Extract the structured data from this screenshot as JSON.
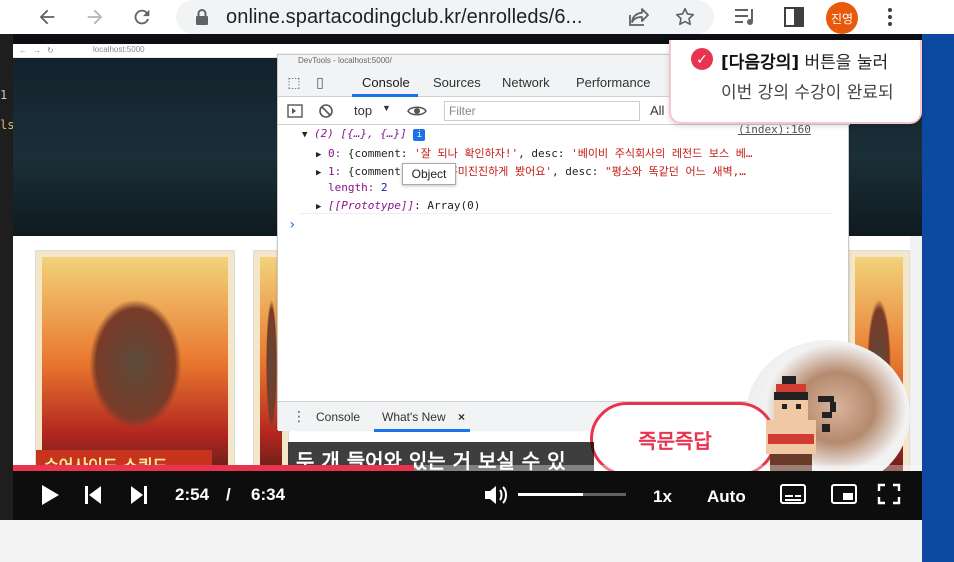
{
  "browser": {
    "url": "online.spartacodingclub.kr/enrolleds/6...",
    "profile_initials": "진영"
  },
  "editor_gutter": [
    "1",
    "ls"
  ],
  "inner_browser": {
    "url": "localhost:5000"
  },
  "devtools": {
    "title": "DevTools - localhost:5000/",
    "tabs": [
      "Console",
      "Sources",
      "Network",
      "Performance"
    ],
    "context": "top",
    "filter_placeholder": "Filter",
    "levels": "All",
    "source_link": "(index):160",
    "console": {
      "summary": "(2) [{…}, {…}]",
      "row0_index": "0:",
      "row0_comment_key": "{comment:",
      "row0_comment": "'잘 되나 확인하자!'",
      "row0_desc_key": ", desc:",
      "row0_desc": "'베이비 주식회사의 레전드 보스 베…",
      "row1_index": "1:",
      "row1_comment_key": "{comment:",
      "row1_comment": "'정말 흥미진진하게 봤어요'",
      "row1_desc_key": ", desc:",
      "row1_desc": "\"평소와 똑같던 어느 새벽,…",
      "length_key": "length:",
      "length_val": "2",
      "proto_key": "[[Prototype]]",
      "proto_val": ": Array(0)",
      "prompt": "›"
    },
    "tooltip": "Object",
    "drawer_tabs": [
      "Console",
      "What's New"
    ],
    "drawer_close": "×"
  },
  "toast": {
    "highlight": "[다음강의]",
    "line1_rest": " 버튼을 눌러",
    "line2": "이번 강의 수강이 완료되"
  },
  "badge": {
    "label": "즉문즉답"
  },
  "subtitle": "두 개 들어와 있는 거 보실 수 있",
  "poster_caption": "수어사이드 스쿼드",
  "player": {
    "current_time": "2:54",
    "separator": "/",
    "duration": "6:34",
    "progress_fraction": 0.4416,
    "volume_fraction": 0.6,
    "speed": "1x",
    "quality": "Auto"
  },
  "colors": {
    "accent": "#e8344e",
    "devtools_blue": "#1a73e8",
    "avatar": "#e8590c"
  }
}
